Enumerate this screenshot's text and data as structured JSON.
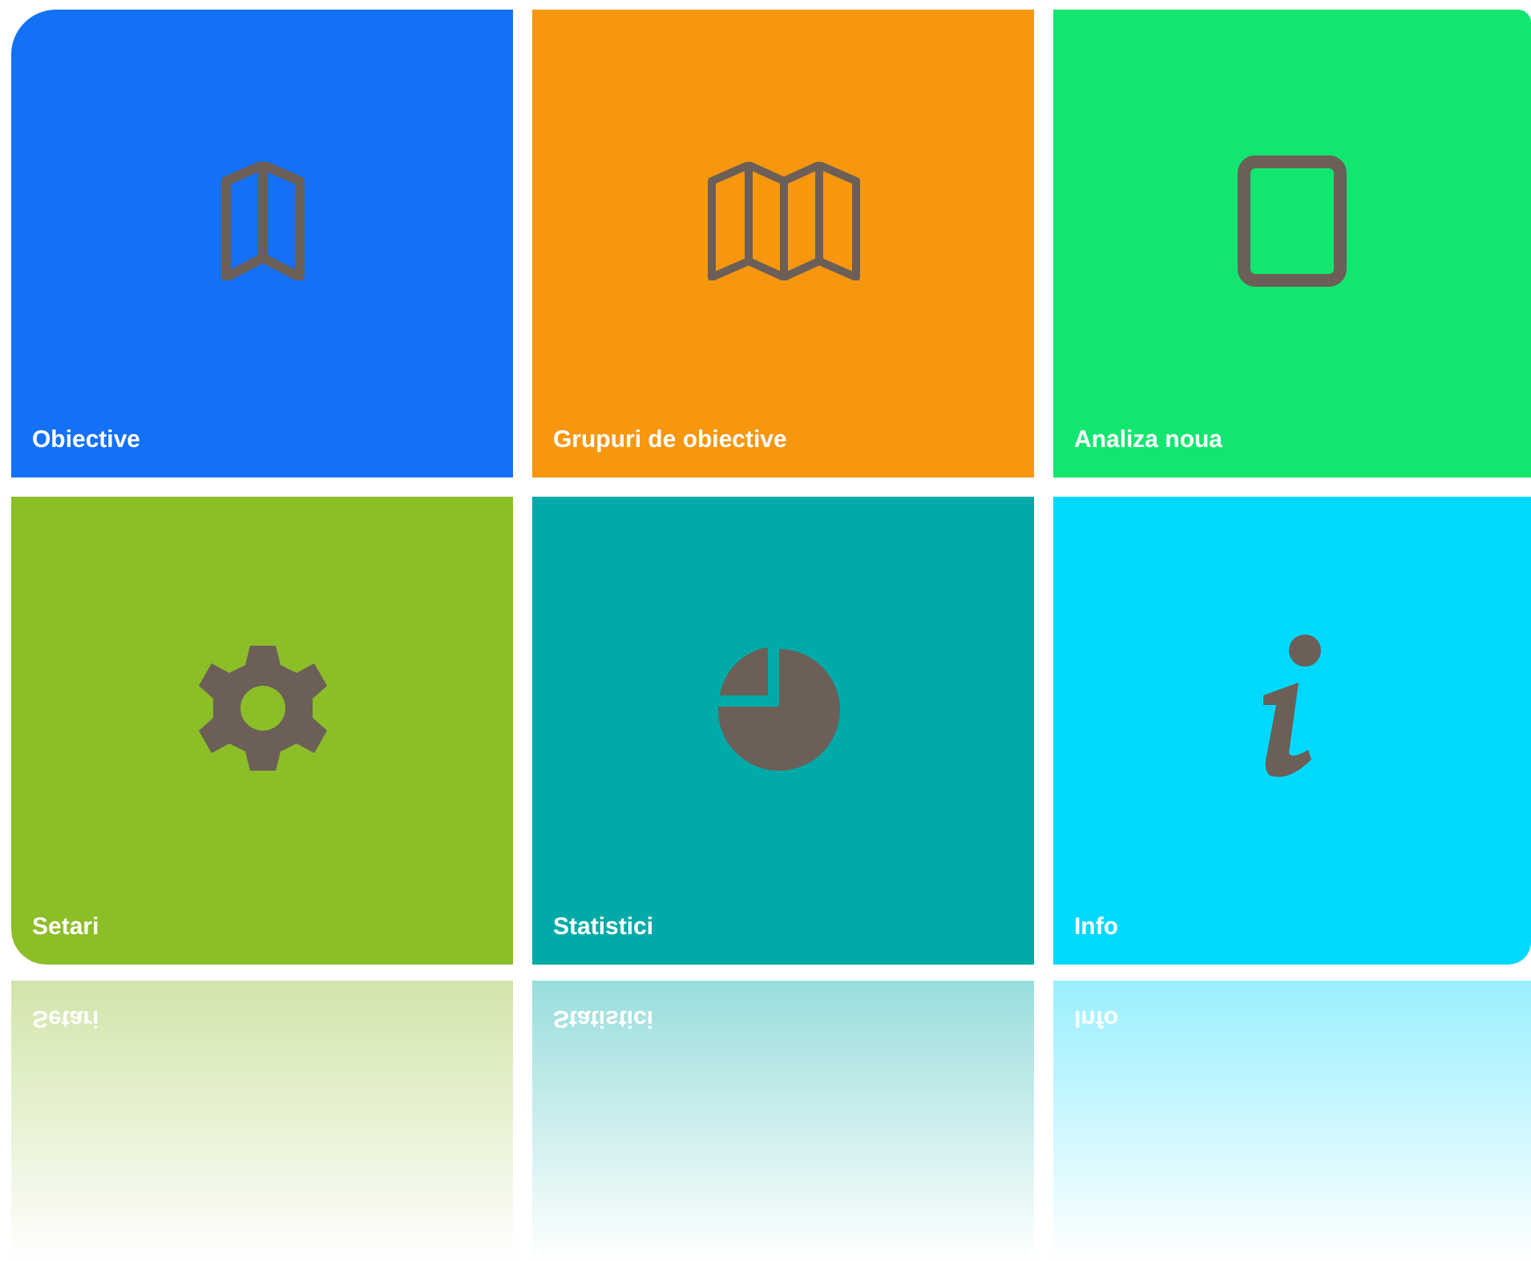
{
  "tiles": [
    {
      "label": "Obiective",
      "color": "#1470f5",
      "kind": "book"
    },
    {
      "label": "Grupuri de obiective",
      "color": "#f7960f",
      "kind": "map"
    },
    {
      "label": "Analiza noua",
      "color": "#13e670",
      "kind": "tablet"
    },
    {
      "label": "Setari",
      "color": "#8cbe28",
      "kind": "gear"
    },
    {
      "label": "Statistici",
      "color": "#00aaa8",
      "kind": "pie"
    },
    {
      "label": "Info",
      "color": "#00d9ff",
      "kind": "info"
    }
  ],
  "reflection": [
    {
      "label": "Setari"
    },
    {
      "label": "Statistici"
    },
    {
      "label": "Info"
    }
  ]
}
